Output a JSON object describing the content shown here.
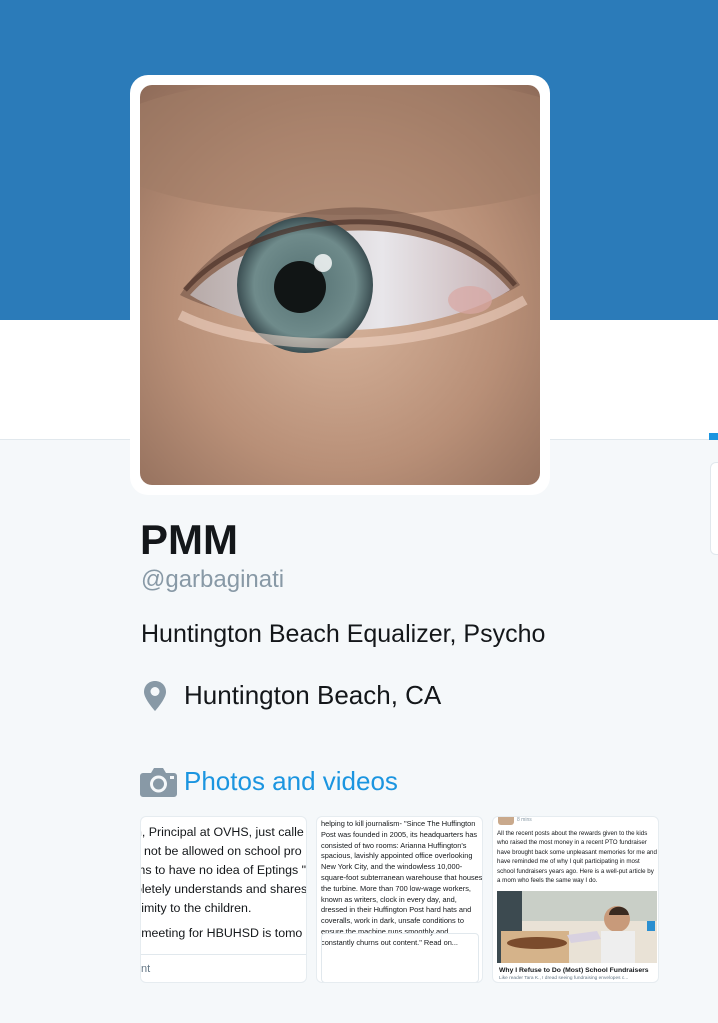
{
  "profile": {
    "name": "PMM",
    "handle": "@garbaginati",
    "bio": "Huntington Beach Equalizer, Psycho",
    "location": "Huntington Beach, CA"
  },
  "icons": {
    "location": "map-pin-icon",
    "photos": "camera-icon"
  },
  "colors": {
    "banner": "#2b7bb9",
    "link": "#1b95e0",
    "muted": "#8899a6",
    "background": "#f5f8fa"
  },
  "media": {
    "section_label": "Photos and videos",
    "thumbs": [
      {
        "lines": [
          "n, Principal at OVHS, just calle",
          "ll not be allowed on school pro",
          "ms to have no idea of Eptings \"",
          "pletely understands and shares",
          "ximity to the children.",
          "l meeting for HBUHSD is tomo"
        ],
        "footer": "nt"
      },
      {
        "text": "helping to kill journalism- \"Since The Huffington Post was founded in 2005, its headquarters has consisted of two rooms: Arianna Huffington's spacious, lavishly appointed office overlooking New York City, and the windowless 10,000-square-foot subterranean warehouse that houses the turbine. More than 700 low-wage workers, known as writers, clock in every day, and, dressed in their Huffington Post hard hats and coveralls, work in dark, unsafe conditions to ensure the machine runs smoothly and constantly churns out content.\" Read on..."
      },
      {
        "meta": "8 mins",
        "text": "All the recent posts about the rewards given to the kids who raised the most money in a recent PTO fundraiser have brought back some unpleasant memories for me and have reminded me of why I quit participating in most school fundraisers years ago. Here is a well-put article by a mom who feels the same way I do.",
        "title": "Why I Refuse to Do (Most) School Fundraisers",
        "subtitle": "Like reader Tara K., I dread seeing fundraising envelopes c..."
      }
    ]
  }
}
